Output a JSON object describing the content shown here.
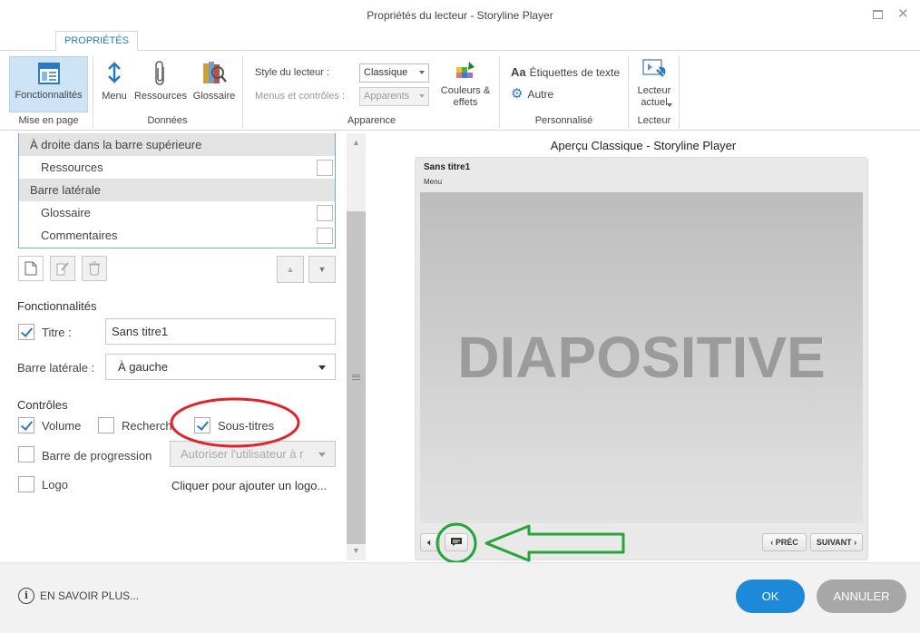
{
  "window": {
    "title": "Propriétés du lecteur - Storyline Player"
  },
  "ribbon": {
    "tab": "PROPRIÉTÉS",
    "buttons": {
      "features": "Fonctionnalités",
      "menu": "Menu",
      "resources": "Ressources",
      "glossary": "Glossaire",
      "colors": "Couleurs &\neffets",
      "text_labels": "Étiquettes de texte",
      "other": "Autre",
      "current_player": "Lecteur\nactuel"
    },
    "groups": {
      "layout": "Mise en page",
      "data": "Données",
      "appearance": "Apparence",
      "custom": "Personnalisé",
      "player": "Lecteur"
    },
    "player_style": {
      "label": "Style du lecteur :",
      "value": "Classique"
    },
    "menus_controls": {
      "label": "Menus et contrôles :",
      "value": "Apparents"
    },
    "colors": {
      "accent": "#2b79c2",
      "selected_bg": "#cde3f6",
      "ok": "#1c8ad8",
      "cancel": "#a7a7a7",
      "annotation_red": "#e0232a",
      "annotation_green": "#26a33a"
    }
  },
  "tab_list": [
    {
      "type": "header",
      "label": "À droite dans la barre supérieure"
    },
    {
      "type": "item",
      "label": "Ressources",
      "checked": false
    },
    {
      "type": "header",
      "label": "Barre latérale"
    },
    {
      "type": "item",
      "label": "Glossaire",
      "checked": false
    },
    {
      "type": "item",
      "label": "Commentaires",
      "checked": false
    }
  ],
  "features": {
    "heading": "Fonctionnalités",
    "title": {
      "label": "Titre :",
      "checked": true,
      "value": "Sans titre1"
    },
    "sidebar": {
      "label": "Barre latérale :",
      "value": "À gauche"
    }
  },
  "controls": {
    "heading": "Contrôles",
    "volume": {
      "label": "Volume",
      "checked": true
    },
    "search": {
      "label": "Recherch",
      "checked": false
    },
    "captions": {
      "label": "Sous-titres",
      "checked": true
    },
    "seekbar": {
      "label": "Barre de progression",
      "checked": false,
      "option": "Autoriser l'utilisateur à r"
    },
    "logo": {
      "label": "Logo",
      "checked": false,
      "add_link": "Cliquer pour ajouter un logo..."
    }
  },
  "preview": {
    "heading": "Aperçu Classique - Storyline Player",
    "course_title": "Sans titre1",
    "menu_label": "Menu",
    "slide_text": "DIAPOSITIVE",
    "prev_label": "PRÉC",
    "next_label": "SUIVANT"
  },
  "footer": {
    "learn_more": "EN SAVOIR PLUS...",
    "ok": "OK",
    "cancel": "ANNULER"
  }
}
